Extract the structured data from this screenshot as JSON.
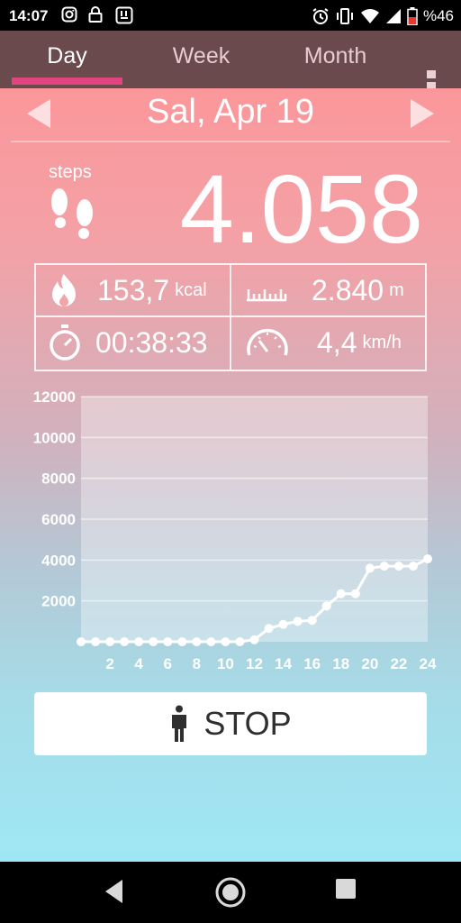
{
  "status_bar": {
    "time": "14:07",
    "battery": "%46",
    "icons": [
      "instagram-icon",
      "lock-icon",
      "vibrate-app-icon",
      "alarm-icon",
      "vibrate-icon",
      "wifi-icon",
      "signal-icon",
      "battery-icon"
    ]
  },
  "tabs": [
    {
      "label": "Day",
      "active": true
    },
    {
      "label": "Week",
      "active": false
    },
    {
      "label": "Month",
      "active": false
    }
  ],
  "date": "Sal, Apr 19",
  "steps": {
    "label": "steps",
    "count": "4.058"
  },
  "stats": {
    "calories": {
      "value": "153,7",
      "unit": "kcal"
    },
    "distance": {
      "value": "2.840",
      "unit": "m"
    },
    "duration": {
      "value": "00:38:33"
    },
    "speed": {
      "value": "4,4",
      "unit": "km/h"
    }
  },
  "chart_data": {
    "type": "line",
    "x": [
      0,
      1,
      2,
      3,
      4,
      5,
      6,
      7,
      8,
      9,
      10,
      11,
      12,
      13,
      14,
      15,
      16,
      17,
      18,
      19,
      20,
      21,
      22,
      23,
      24
    ],
    "values": [
      0,
      0,
      0,
      0,
      0,
      0,
      0,
      0,
      0,
      0,
      0,
      0,
      100,
      650,
      850,
      1000,
      1050,
      1750,
      2350,
      2350,
      3600,
      3700,
      3700,
      3700,
      4058
    ],
    "xticks": [
      "2",
      "4",
      "6",
      "8",
      "10",
      "12",
      "14",
      "16",
      "18",
      "20",
      "22",
      "24"
    ],
    "yticks": [
      "2000",
      "4000",
      "6000",
      "8000",
      "10000",
      "12000"
    ],
    "ylim": [
      0,
      12000
    ],
    "xlim": [
      0,
      24
    ],
    "grid": true,
    "colors": {
      "line": "#ffffff",
      "plot_bg": "rgba(255,255,255,0.35)",
      "grid": "rgba(255,255,255,0.55)"
    }
  },
  "stop_button": {
    "label": "STOP"
  },
  "colors": {
    "tab_bar": "#6a4a4d",
    "tab_indicator": "#e0457f"
  }
}
